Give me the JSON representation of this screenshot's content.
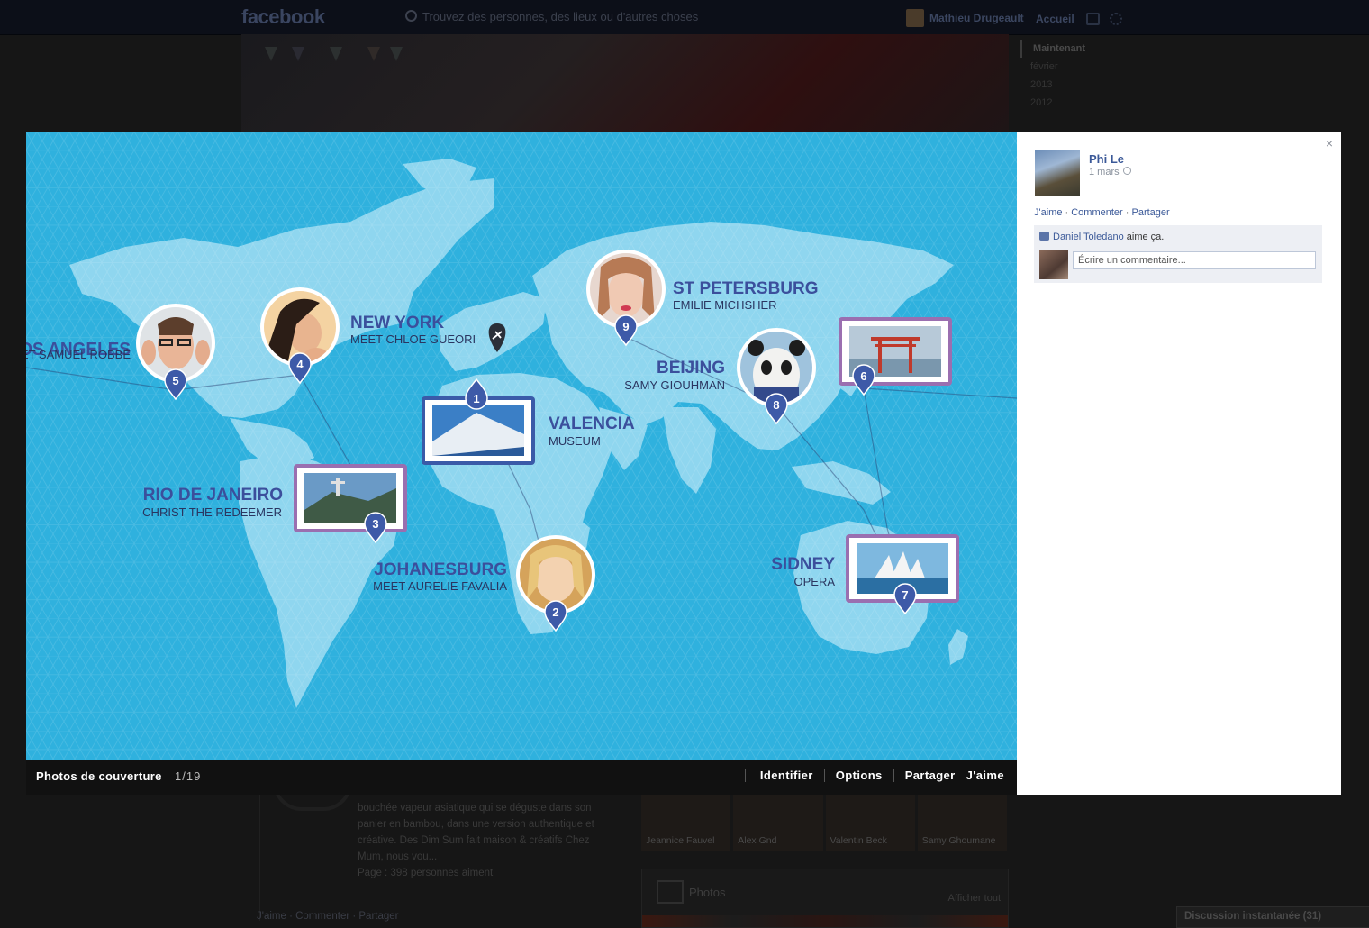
{
  "fb": {
    "logo": "facebook",
    "search_placeholder": "Trouvez des personnes, des lieux ou d'autres choses",
    "user_name": "Mathieu Drugeault",
    "home": "Accueil"
  },
  "timeline": [
    "Maintenant",
    "février",
    "2013",
    "2012"
  ],
  "background_post": {
    "text": "bouchée vapeur asiatique qui se déguste dans son panier en bambou, dans une version authentique et créative. Des Dim Sum fait maison & créatifs Chez Mum, nous vou...",
    "page_likes": "Page : 398 personnes aiment",
    "actions": "J'aime · Commenter · Partager"
  },
  "friends": [
    "Jeannice Fauvel",
    "Alex Gnd",
    "Valentin Beck",
    "Samy Ghoumane"
  ],
  "photos_box": {
    "title": "Photos",
    "see_all": "Afficher tout"
  },
  "chat": "Discussion instantanée (31)",
  "viewer": {
    "album": "Photos de couverture",
    "counter": "1/19",
    "actions": [
      "Identifier",
      "Options",
      "Partager",
      "J'aime"
    ]
  },
  "map": {
    "colors": {
      "ocean": "#2fb1de",
      "land": "#8fd6ef",
      "pin": "#3d5aa8",
      "title": "#3b4f9c",
      "sub": "#2a3560",
      "stamp_blue": "#3a5aa8",
      "stamp_purple": "#9a6fb0"
    },
    "places": [
      {
        "num": "5",
        "title": "LOS ANGELES",
        "sub": "MEET SAMUEL ROBBÉ",
        "kind": "person"
      },
      {
        "num": "4",
        "title": "NEW YORK",
        "sub": "MEET CHLOE GUEORI",
        "kind": "person"
      },
      {
        "num": "1",
        "title": "VALENCIA",
        "sub": "MUSEUM",
        "kind": "stamp"
      },
      {
        "num": "3",
        "title": "RIO DE JANEIRO",
        "sub": "CHRIST THE REDEEMER",
        "kind": "stamp"
      },
      {
        "num": "2",
        "title": "JOHANESBURG",
        "sub": "MEET AURELIE FAVALIA",
        "kind": "person"
      },
      {
        "num": "9",
        "title": "ST PETERSBURG",
        "sub": "EMILIE MICHSHER",
        "kind": "person"
      },
      {
        "num": "8",
        "title": "BEIJING",
        "sub": "SAMY GIOUHMAN",
        "kind": "person"
      },
      {
        "num": "6",
        "title": "",
        "sub": "",
        "kind": "stamp"
      },
      {
        "num": "7",
        "title": "SIDNEY",
        "sub": "OPERA",
        "kind": "stamp"
      }
    ]
  },
  "panel": {
    "name": "Phi Le",
    "date": "1 mars",
    "actions": [
      "J'aime",
      "Commenter",
      "Partager"
    ],
    "liker": "Daniel Toledano",
    "likes_suffix": "aime ça.",
    "comment_placeholder": "Écrire un commentaire...",
    "close": "×"
  }
}
